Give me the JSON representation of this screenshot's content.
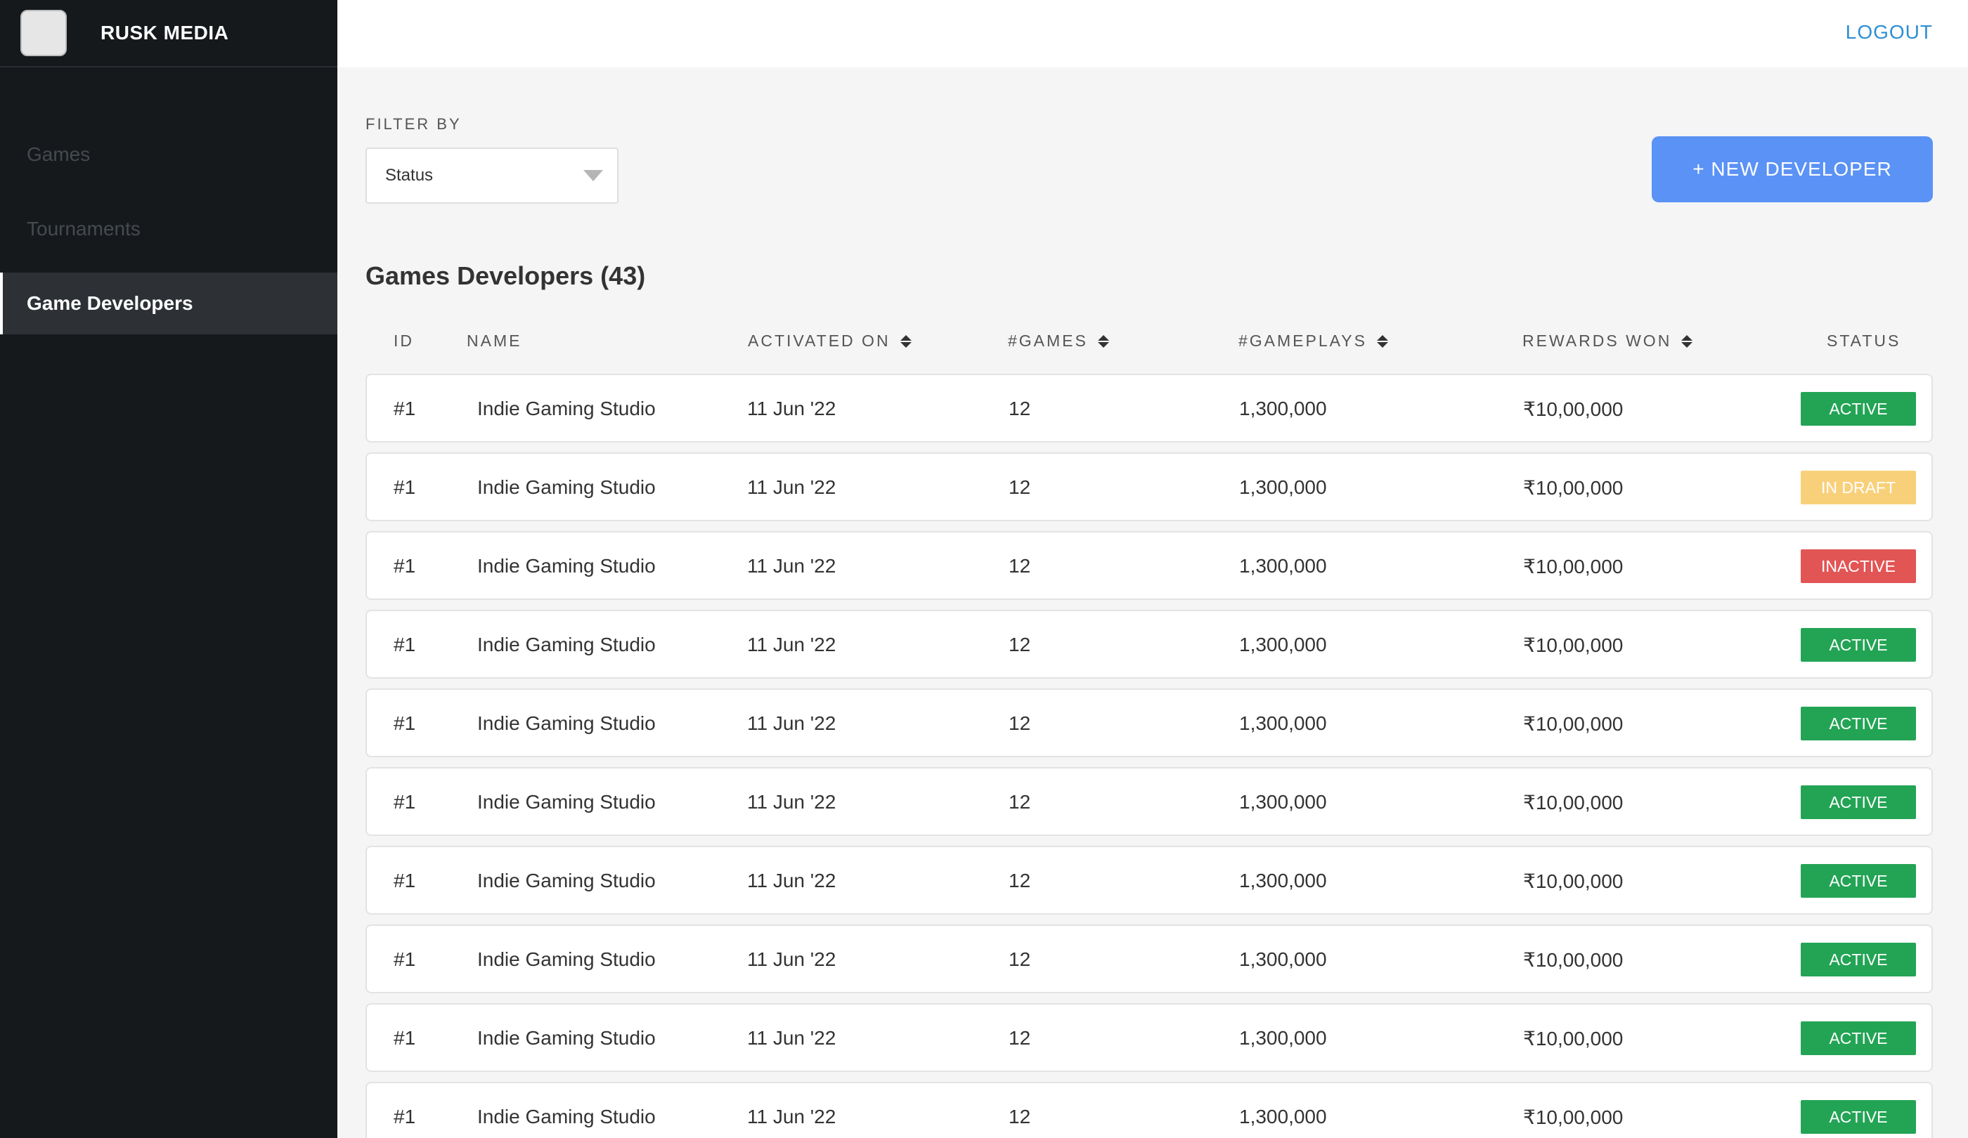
{
  "brand": {
    "name": "RUSK MEDIA"
  },
  "sidebar": {
    "items": [
      {
        "label": "Games"
      },
      {
        "label": "Tournaments"
      },
      {
        "label": "Game Developers"
      }
    ]
  },
  "topbar": {
    "logout_label": "LOGOUT"
  },
  "filter": {
    "label": "FILTER BY",
    "selected": "Status"
  },
  "actions": {
    "new_developer_label": "+ NEW DEVELOPER"
  },
  "section": {
    "title": "Games Developers (43)"
  },
  "table": {
    "headers": [
      "ID",
      "NAME",
      "ACTIVATED ON",
      "#GAMES",
      "#GAMEPLAYS",
      "REWARDS WON",
      "STATUS"
    ],
    "rows": [
      {
        "id": "#1",
        "name": "Indie Gaming Studio",
        "activated_on": "11 Jun '22",
        "games": "12",
        "gameplays": "1,300,000",
        "rewards": "₹10,00,000",
        "status": "ACTIVE"
      },
      {
        "id": "#1",
        "name": "Indie Gaming Studio",
        "activated_on": "11 Jun '22",
        "games": "12",
        "gameplays": "1,300,000",
        "rewards": "₹10,00,000",
        "status": "IN DRAFT"
      },
      {
        "id": "#1",
        "name": "Indie Gaming Studio",
        "activated_on": "11 Jun '22",
        "games": "12",
        "gameplays": "1,300,000",
        "rewards": "₹10,00,000",
        "status": "INACTIVE"
      },
      {
        "id": "#1",
        "name": "Indie Gaming Studio",
        "activated_on": "11 Jun '22",
        "games": "12",
        "gameplays": "1,300,000",
        "rewards": "₹10,00,000",
        "status": "ACTIVE"
      },
      {
        "id": "#1",
        "name": "Indie Gaming Studio",
        "activated_on": "11 Jun '22",
        "games": "12",
        "gameplays": "1,300,000",
        "rewards": "₹10,00,000",
        "status": "ACTIVE"
      },
      {
        "id": "#1",
        "name": "Indie Gaming Studio",
        "activated_on": "11 Jun '22",
        "games": "12",
        "gameplays": "1,300,000",
        "rewards": "₹10,00,000",
        "status": "ACTIVE"
      },
      {
        "id": "#1",
        "name": "Indie Gaming Studio",
        "activated_on": "11 Jun '22",
        "games": "12",
        "gameplays": "1,300,000",
        "rewards": "₹10,00,000",
        "status": "ACTIVE"
      },
      {
        "id": "#1",
        "name": "Indie Gaming Studio",
        "activated_on": "11 Jun '22",
        "games": "12",
        "gameplays": "1,300,000",
        "rewards": "₹10,00,000",
        "status": "ACTIVE"
      },
      {
        "id": "#1",
        "name": "Indie Gaming Studio",
        "activated_on": "11 Jun '22",
        "games": "12",
        "gameplays": "1,300,000",
        "rewards": "₹10,00,000",
        "status": "ACTIVE"
      },
      {
        "id": "#1",
        "name": "Indie Gaming Studio",
        "activated_on": "11 Jun '22",
        "games": "12",
        "gameplays": "1,300,000",
        "rewards": "₹10,00,000",
        "status": "ACTIVE"
      }
    ]
  },
  "status_colors": {
    "ACTIVE": {
      "bg": "#23a455",
      "fg": "#ffffff"
    },
    "IN DRAFT": {
      "bg": "#f9d07a",
      "fg": "#ffffff"
    },
    "INACTIVE": {
      "bg": "#e25555",
      "fg": "#ffffff"
    }
  },
  "colors": {
    "sidebar_bg": "#16191c",
    "accent_button": "#5b92f5",
    "link": "#2d8fd5"
  }
}
